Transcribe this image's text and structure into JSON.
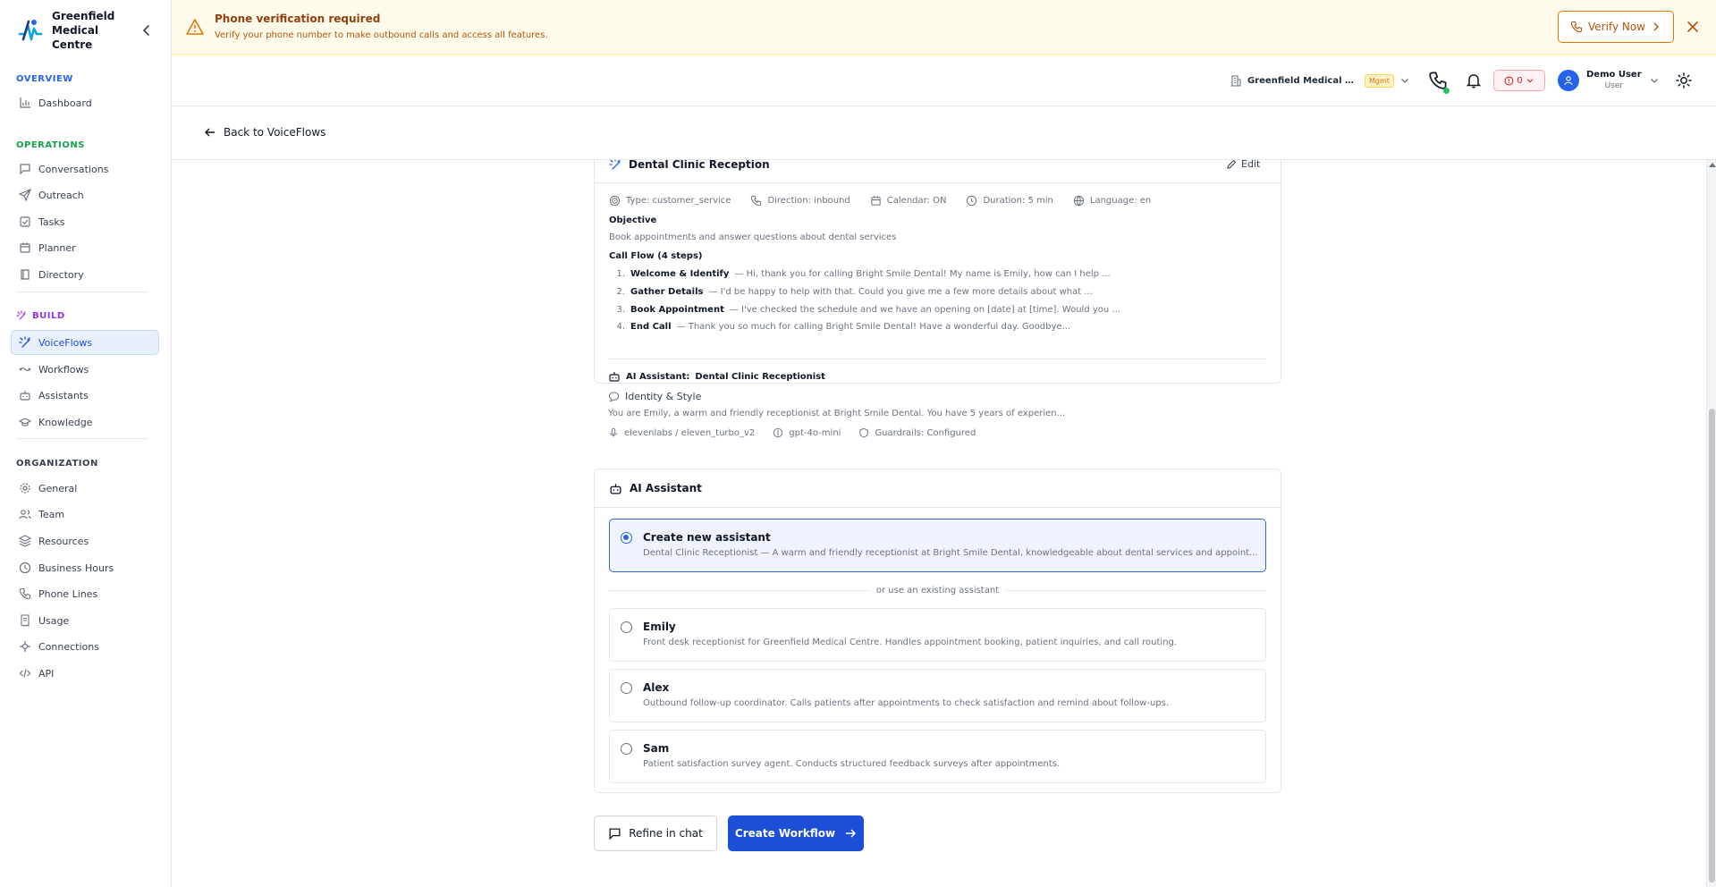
{
  "brand": {
    "name": "Greenfield Medical Centre"
  },
  "sidebar": {
    "sections": [
      {
        "label": "OVERVIEW",
        "color": "#2563eb"
      },
      {
        "label": "OPERATIONS",
        "color": "#16a34a"
      },
      {
        "label": "BUILD",
        "color": "#9333ea"
      },
      {
        "label": "ORGANIZATION",
        "color": "#374151"
      }
    ],
    "items": [
      {
        "label": "Dashboard",
        "icon": "bar-chart-icon"
      },
      {
        "label": "Conversations",
        "icon": "message-icon"
      },
      {
        "label": "Outreach",
        "icon": "send-icon"
      },
      {
        "label": "Tasks",
        "icon": "checkbox-icon"
      },
      {
        "label": "Planner",
        "icon": "calendar-icon"
      },
      {
        "label": "Directory",
        "icon": "book-icon"
      },
      {
        "label": "VoiceFlows",
        "icon": "sparkle-icon",
        "active": true
      },
      {
        "label": "Workflows",
        "icon": "workflow-icon"
      },
      {
        "label": "Assistants",
        "icon": "bot-icon"
      },
      {
        "label": "Knowledge",
        "icon": "graduation-cap-icon"
      },
      {
        "label": "General",
        "icon": "gear-icon"
      },
      {
        "label": "Team",
        "icon": "users-icon"
      },
      {
        "label": "Resources",
        "icon": "layers-icon"
      },
      {
        "label": "Business Hours",
        "icon": "clock-icon"
      },
      {
        "label": "Phone Lines",
        "icon": "phone-icon"
      },
      {
        "label": "Usage",
        "icon": "receipt-icon"
      },
      {
        "label": "Connections",
        "icon": "plug-icon"
      },
      {
        "label": "API",
        "icon": "code-icon"
      }
    ]
  },
  "banner": {
    "title": "Phone verification required",
    "description": "Verify your phone number to make outbound calls and access all features.",
    "verify_label": "Verify Now"
  },
  "topbar": {
    "org_name": "Greenfield Medical Ce...",
    "org_badge": "Mgmt",
    "credits": "0",
    "user_name": "Demo User",
    "user_role": "User"
  },
  "back": {
    "label": "Back to VoiceFlows"
  },
  "flow": {
    "title": "Dental Clinic Reception",
    "edit_label": "Edit",
    "meta": [
      {
        "text": "Type: customer_service",
        "icon": "target-icon"
      },
      {
        "text": "Direction: inbound",
        "icon": "phone-icon"
      },
      {
        "text": "Calendar: ON",
        "icon": "calendar-icon"
      },
      {
        "text": "Duration: 5 min",
        "icon": "clock-icon"
      },
      {
        "text": "Language: en",
        "icon": "globe-icon"
      }
    ],
    "objective_label": "Objective",
    "objective": "Book appointments and answer questions about dental services",
    "call_flow_label": "Call Flow (4 steps)",
    "steps": [
      {
        "num": "1.",
        "name": "Welcome & Identify",
        "desc": "— Hi, thank you for calling Bright Smile Dental! My name is Emily, how can I help ..."
      },
      {
        "num": "2.",
        "name": "Gather Details",
        "desc": "— I'd be happy to help with that. Could you give me a few more details about what ..."
      },
      {
        "num": "3.",
        "name": "Book Appointment",
        "desc": "— I've checked the schedule and we have an opening on [date] at [time]. Would you ..."
      },
      {
        "num": "4.",
        "name": "End Call",
        "desc": "— Thank you so much for calling Bright Smile Dental! Have a wonderful day. Goodbye..."
      }
    ],
    "ai_assistant_label": "AI Assistant:",
    "ai_assistant_name": "Dental Clinic Receptionist",
    "identity_label": "Identity & Style",
    "identity_text": "You are Emily, a warm and friendly receptionist at Bright Smile Dental. You have 5 years of experien...",
    "voice": "elevenlabs / eleven_turbo_v2",
    "model": "gpt-4o-mini",
    "guardrails": "Guardrails: Configured"
  },
  "assistant_select": {
    "title": "AI Assistant",
    "new_option": {
      "title": "Create new assistant",
      "desc": "Dental Clinic Receptionist — A warm and friendly receptionist at Bright Smile Dental, knowledgeable about dental services and appoint...",
      "selected": true
    },
    "or_label": "or use an existing assistant",
    "existing": [
      {
        "title": "Emily",
        "desc": "Front desk receptionist for Greenfield Medical Centre. Handles appointment booking, patient inquiries, and call routing."
      },
      {
        "title": "Alex",
        "desc": "Outbound follow-up coordinator. Calls patients after appointments to check satisfaction and remind about follow-ups."
      },
      {
        "title": "Sam",
        "desc": "Patient satisfaction survey agent. Conducts structured feedback surveys after appointments."
      }
    ]
  },
  "actions": {
    "refine_label": "Refine in chat",
    "create_label": "Create Workflow"
  },
  "colors": {
    "accent": "#1d4ed8",
    "warning": "#d97706",
    "success": "#22c55e",
    "danger": "#dc2626"
  }
}
